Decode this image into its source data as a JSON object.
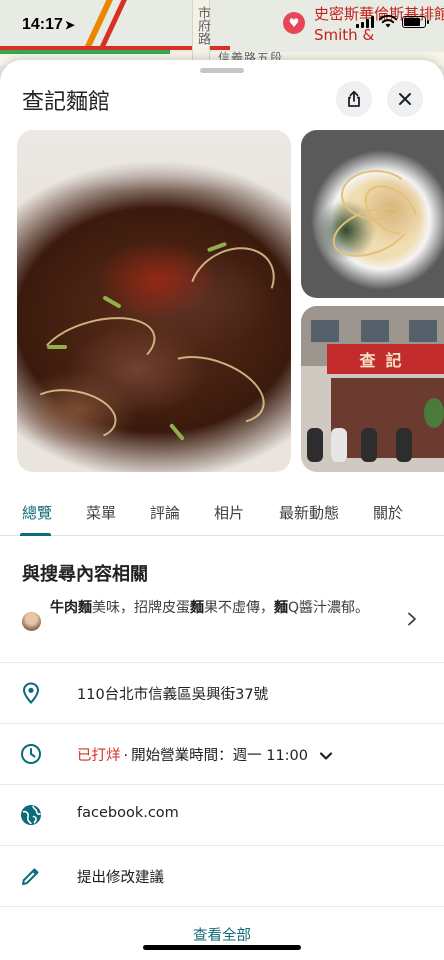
{
  "status_bar": {
    "time": "14:17",
    "location_arrow": "location-arrow-icon"
  },
  "map": {
    "vertical_street": "市府路",
    "road": "信義路五段",
    "place_name": "史密斯華倫斯基排館 Smith &"
  },
  "place": {
    "name": "查記麵館"
  },
  "icons": {
    "share": "share-icon",
    "close": "close-icon"
  },
  "tabs": [
    {
      "label": "總覽",
      "active": true
    },
    {
      "label": "菜單"
    },
    {
      "label": "評論"
    },
    {
      "label": "相片"
    },
    {
      "label": "最新動態"
    },
    {
      "label": "關於"
    }
  ],
  "related": {
    "title": "與搜尋內容相關",
    "highlight_1": "牛肉麵",
    "text_1": "美味，招牌皮蛋",
    "highlight_2": "麵",
    "text_2": "果不虛傳，",
    "highlight_3": "麵",
    "text_3": "Q醬汁濃郁。"
  },
  "info": {
    "address": "110台北市信義區吳興街37號",
    "hours_status": "已打烊",
    "hours_separator": "·",
    "hours_text": "開始營業時間：週一 11:00",
    "website": "facebook.com",
    "suggest_edit": "提出修改建議"
  },
  "view_all": "查看全部",
  "colors": {
    "accent": "#0b6b78",
    "closed": "#d93025",
    "map_place": "#c5221f"
  }
}
